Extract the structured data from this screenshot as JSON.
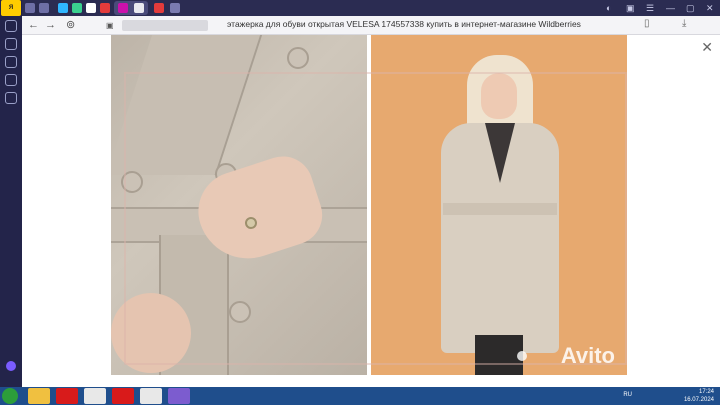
{
  "browser": {
    "page_title": "этажерка для обуви открытая VELESA 174557338 купить в интернет-магазине Wildberries",
    "rail_badge": "Yandex"
  },
  "colors": {
    "rail": "#23244a",
    "tabstrip": "#2b2c52",
    "taskbar": "#1f4e8c",
    "photo_background": "#e7a96f"
  },
  "icons": {
    "back": "←",
    "forward": "→",
    "reload": "⟳",
    "protect": "⊚",
    "lock": "🔒",
    "bookmark": "▯",
    "downloads": "⤓",
    "close": "✕",
    "minimize": "—",
    "maximize": "▢"
  },
  "watermark": {
    "text": "Avito"
  },
  "taskbar": {
    "language": "RU",
    "time": "17:24",
    "date": "16.07.2024"
  }
}
